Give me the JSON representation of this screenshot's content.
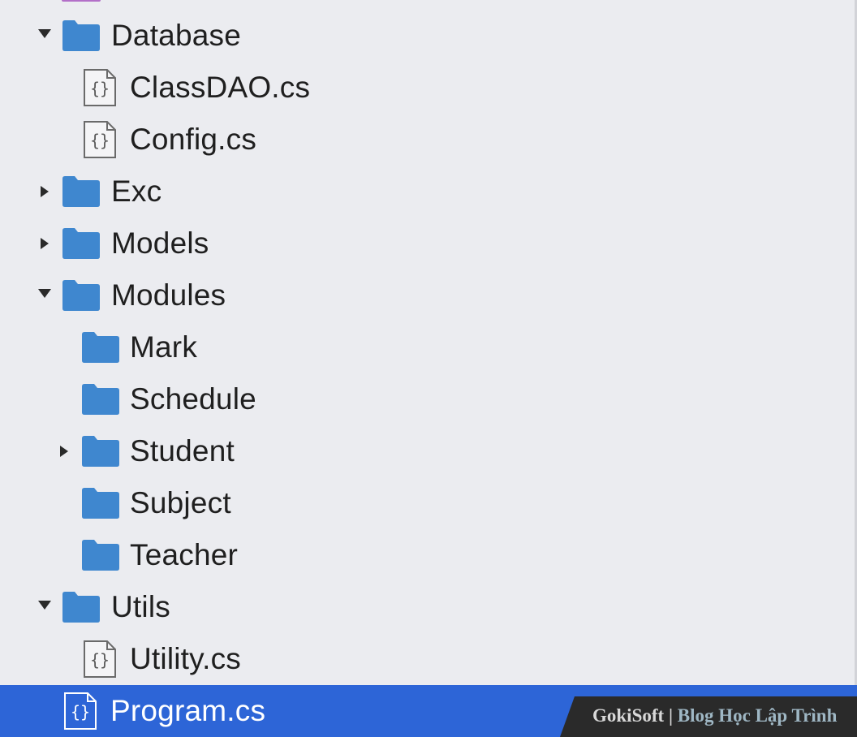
{
  "colors": {
    "background": "#ebecf0",
    "folder": "#3f87cf",
    "selection": "#2d65d7",
    "text": "#1f1f1f"
  },
  "tree": {
    "items": [
      {
        "label": "Database",
        "type": "folder",
        "expanded": true
      },
      {
        "label": "ClassDAO.cs",
        "type": "file"
      },
      {
        "label": "Config.cs",
        "type": "file"
      },
      {
        "label": "Exc",
        "type": "folder",
        "expanded": false
      },
      {
        "label": "Models",
        "type": "folder",
        "expanded": false
      },
      {
        "label": "Modules",
        "type": "folder",
        "expanded": true
      },
      {
        "label": "Mark",
        "type": "folder"
      },
      {
        "label": "Schedule",
        "type": "folder"
      },
      {
        "label": "Student",
        "type": "folder",
        "expanded": false
      },
      {
        "label": "Subject",
        "type": "folder"
      },
      {
        "label": "Teacher",
        "type": "folder"
      },
      {
        "label": "Utils",
        "type": "folder",
        "expanded": true
      },
      {
        "label": "Utility.cs",
        "type": "file"
      },
      {
        "label": "Program.cs",
        "type": "file",
        "selected": true
      }
    ]
  },
  "watermark": {
    "brand": "GokiSoft",
    "separator": "|",
    "tagline": "Blog Học Lập Trình"
  }
}
